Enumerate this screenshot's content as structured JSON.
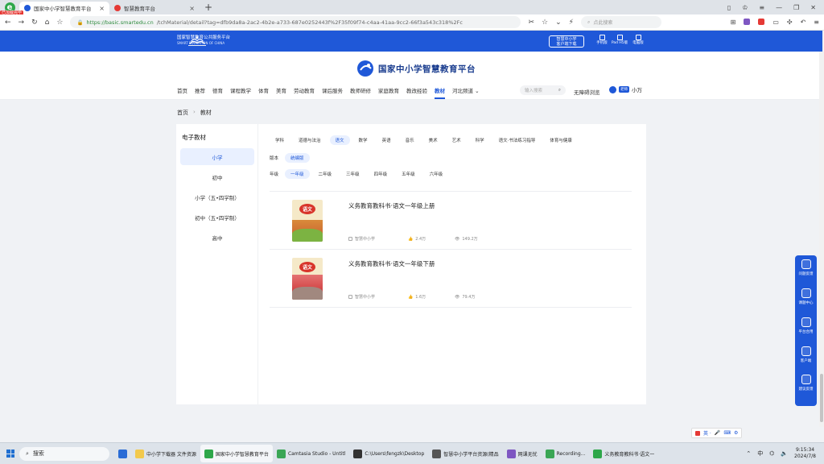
{
  "browser": {
    "badge": "已加载完毕",
    "tabs": [
      {
        "title": "国家中小学智慧教育平台",
        "color": "#1f58d8",
        "active": true
      },
      {
        "title": "智慧教育平台",
        "color": "#e53935",
        "active": false
      }
    ],
    "new_tab": "+",
    "url_host": "https://basic.smartedu.cn",
    "url_path": "/tchMaterial/detail?tag=dfb9da8a-2ac2-4b2e-a733-687e0252443f%2F35f09f74-c4aa-41aa-9cc2-66f3a543c318%2Fc",
    "search_placeholder": "点此搜索"
  },
  "site": {
    "small_logo_line1": "国家智慧教育公共服务平台",
    "small_logo_line2": "SMART EDUCATION OF CHINA",
    "download_line1": "智慧中小学",
    "download_line2": "客户端下载",
    "top_icons": [
      "手机版",
      "Pad H5版",
      "电脑版"
    ],
    "main_title": "国家中小学智慧教育平台",
    "nav": [
      "首页",
      "推荐",
      "德育",
      "课程教学",
      "体育",
      "美育",
      "劳动教育",
      "课后服务",
      "教师研修",
      "家庭教育",
      "教改经验",
      "教材",
      "河北频道 ⌄"
    ],
    "nav_active_index": 11,
    "search_placeholder": "输入搜索",
    "barrier_free": "无障碍浏览",
    "user_role": "老师",
    "user_name": "小万"
  },
  "breadcrumb": [
    "首页",
    "教材"
  ],
  "sidebar": {
    "title": "电子教材",
    "items": [
      "小学",
      "初中",
      "小学（五•四学制）",
      "初中（五•四学制）",
      "高中"
    ],
    "active_index": 0
  },
  "filters": {
    "subjects": [
      "学科",
      "道德与法治",
      "语文",
      "数学",
      "英语",
      "音乐",
      "美术",
      "艺术",
      "科学",
      "语文·书法练习指导",
      "体育与健康"
    ],
    "subject_active": 2,
    "editions_label": "版本",
    "editions": [
      "统编版"
    ],
    "grade_label": "年级",
    "grades": [
      "一年级",
      "二年级",
      "三年级",
      "四年级",
      "五年级",
      "六年级"
    ],
    "grade_active": 0
  },
  "books": [
    {
      "title": "义务教育教科书·语文一年级上册",
      "cover_text": "语文",
      "source": "智慧中小学",
      "likes": "2.4万",
      "views": "149.2万"
    },
    {
      "title": "义务教育教科书·语文一年级下册",
      "cover_text": "语文",
      "source": "智慧中小学",
      "likes": "1.6万",
      "views": "79.4万"
    }
  ],
  "float_panel": [
    "问题反馈",
    "课题中心",
    "平台合用",
    "客户端",
    "建议反馈"
  ],
  "ime": "英 ·",
  "taskbar": {
    "search": "搜索",
    "apps": [
      {
        "label": "",
        "color": "#2a6cd6"
      },
      {
        "label": "中小学下载器  文件资源",
        "color": "#f2c94c"
      },
      {
        "label": "国家中小学智慧教育平台",
        "color": "#2ea74a"
      },
      {
        "label": "Camtasia Studio - Untitl",
        "color": "#3aa655"
      },
      {
        "label": "C:\\Users\\fengzk\\Desktop",
        "color": "#333333"
      },
      {
        "label": "智慧中小学平台资源(精品",
        "color": "#555555"
      },
      {
        "label": "网课无忧",
        "color": "#7e57c2"
      },
      {
        "label": "Recording...",
        "color": "#3aa655"
      },
      {
        "label": "义务教育教科书·语文一",
        "color": "#2ea74a"
      }
    ],
    "time": "9:15:34",
    "date": "2024/7/8"
  }
}
